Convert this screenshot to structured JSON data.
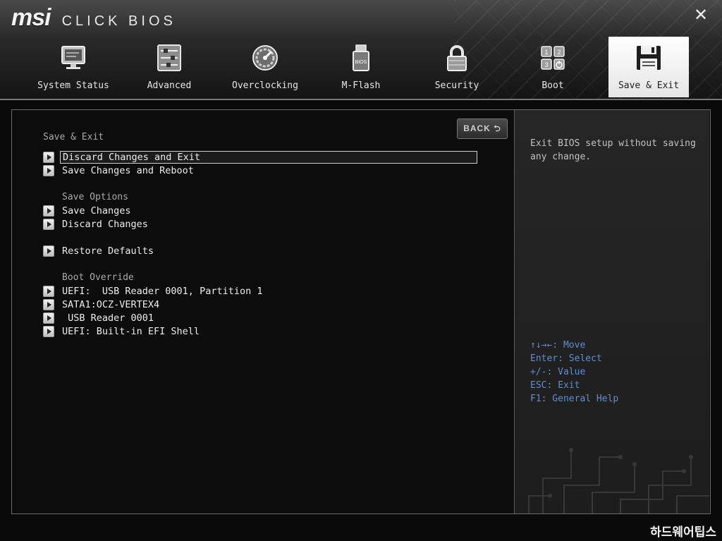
{
  "header": {
    "brand": "msi",
    "product": "CLICK BIOS",
    "close_glyph": "✕"
  },
  "tabs": [
    {
      "label": "System Status",
      "icon": "monitor-icon"
    },
    {
      "label": "Advanced",
      "icon": "settings-sliders-icon"
    },
    {
      "label": "Overclocking",
      "icon": "gauge-icon"
    },
    {
      "label": "M-Flash",
      "icon": "usb-drive-icon"
    },
    {
      "label": "Security",
      "icon": "lock-icon"
    },
    {
      "label": "Boot",
      "icon": "boot-order-icon"
    },
    {
      "label": "Save & Exit",
      "icon": "floppy-disk-icon",
      "active": true
    }
  ],
  "main": {
    "back_label": "BACK ⮌",
    "page_title": "Save & Exit",
    "items_top": [
      {
        "label": "Discard Changes and Exit",
        "selected": true
      },
      {
        "label": "Save Changes and Reboot"
      }
    ],
    "save_options_title": "Save Options",
    "save_options": [
      {
        "label": "Save Changes"
      },
      {
        "label": "Discard Changes"
      }
    ],
    "restore_defaults": "Restore Defaults",
    "boot_override_title": "Boot Override",
    "boot_override": [
      {
        "label": "UEFI:  USB Reader 0001, Partition 1"
      },
      {
        "label": "SATA1:OCZ-VERTEX4"
      },
      {
        "label": " USB Reader 0001"
      },
      {
        "label": "UEFI: Built-in EFI Shell"
      }
    ]
  },
  "help": {
    "description": "Exit BIOS setup without saving any change.",
    "keys": [
      "↑↓→←: Move",
      "Enter: Select",
      "+/-: Value",
      "ESC: Exit",
      "F1: General Help"
    ]
  },
  "footer": {
    "watermark": "하드웨어팁스"
  },
  "colors": {
    "accent_blue": "#5d8fd3",
    "active_tab_bg": "#f2f2f2",
    "panel_border": "#6a6a6a"
  }
}
